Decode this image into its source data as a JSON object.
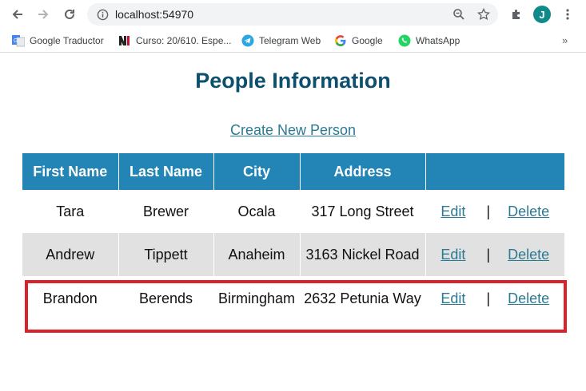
{
  "browser": {
    "url": "localhost:54970",
    "avatar_letter": "J",
    "bookmarks": [
      {
        "label": "Google Traductor",
        "icon": "google-translate-icon"
      },
      {
        "label": "Curso: 20/610. Espe...",
        "icon": "ni-logo-icon"
      },
      {
        "label": "Telegram Web",
        "icon": "telegram-icon"
      },
      {
        "label": "Google",
        "icon": "google-icon"
      },
      {
        "label": "WhatsApp",
        "icon": "whatsapp-icon"
      }
    ],
    "more": "»"
  },
  "page": {
    "title": "People Information",
    "create_link": "Create New Person"
  },
  "table": {
    "headers": [
      "First Name",
      "Last Name",
      "City",
      "Address",
      ""
    ],
    "rows": [
      {
        "first": "Tara",
        "last": "Brewer",
        "city": "Ocala",
        "address": "317 Long Street",
        "edit": "Edit",
        "sep": "|",
        "delete": "Delete"
      },
      {
        "first": "Andrew",
        "last": "Tippett",
        "city": "Anaheim",
        "address": "3163 Nickel Road",
        "edit": "Edit",
        "sep": "|",
        "delete": "Delete"
      },
      {
        "first": "Brandon",
        "last": "Berends",
        "city": "Birmingham",
        "address": "2632 Petunia Way",
        "edit": "Edit",
        "sep": "|",
        "delete": "Delete"
      }
    ]
  },
  "colors": {
    "header_bg": "#2385b5",
    "title": "#0d4f6e",
    "link": "#2b7a94",
    "alt_row": "#e1e1e1",
    "highlight": "#d9222a"
  }
}
